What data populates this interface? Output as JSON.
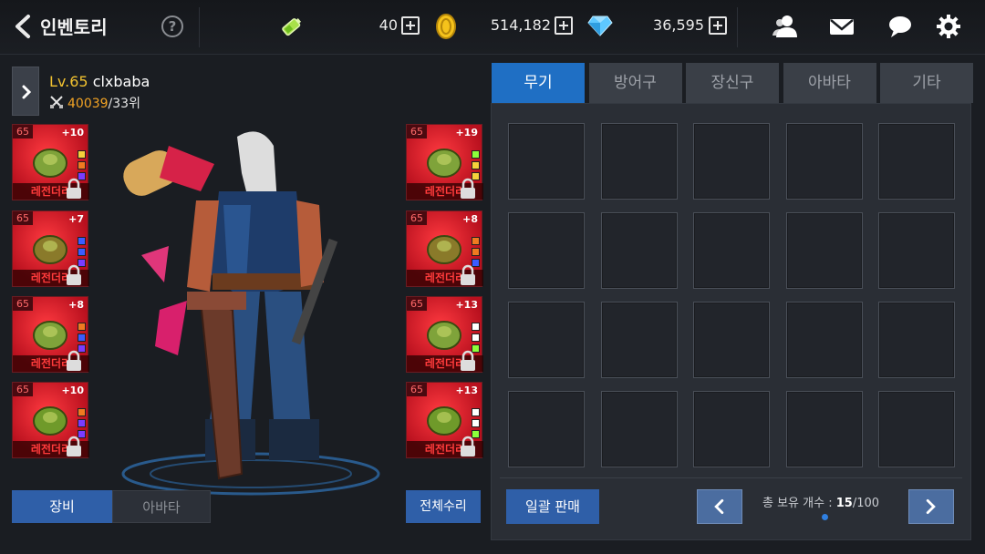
{
  "header": {
    "title": "인벤토리",
    "help": "?",
    "stamina": "40",
    "gold": "514,182",
    "gems": "36,595"
  },
  "character": {
    "level_prefix": "Lv.65",
    "name": "clxbaba",
    "power": "40039",
    "rank": "/33위"
  },
  "equip_left": [
    {
      "level": "65",
      "enhance": "+10",
      "grade": "레전더리",
      "gems": [
        "#f5d13b",
        "#f07a20",
        "#7a3cff"
      ]
    },
    {
      "level": "65",
      "enhance": "+7",
      "grade": "레전더리",
      "gems": [
        "#3b5cff",
        "#3b5cff",
        "#7a3cff"
      ]
    },
    {
      "level": "65",
      "enhance": "+8",
      "grade": "레전더리",
      "gems": [
        "#f07a20",
        "#3b5cff",
        "#7a3cff"
      ]
    },
    {
      "level": "65",
      "enhance": "+10",
      "grade": "레전더리",
      "gems": [
        "#f07a20",
        "#7a3cff",
        "#7a3cff"
      ]
    }
  ],
  "equip_right": [
    {
      "level": "65",
      "enhance": "+19",
      "grade": "레전더리",
      "gems": [
        "#8cff3b",
        "#f5d13b",
        "#f5d13b"
      ]
    },
    {
      "level": "65",
      "enhance": "+8",
      "grade": "레전더리",
      "gems": [
        "#f07a20",
        "#f07a20",
        "#3b5cff"
      ]
    },
    {
      "level": "65",
      "enhance": "+13",
      "grade": "레전더리",
      "gems": [
        "#ffffff",
        "#ffffff",
        "#8cff3b"
      ]
    },
    {
      "level": "65",
      "enhance": "+13",
      "grade": "레전더리",
      "gems": [
        "#ffffff",
        "#ffffff",
        "#8cff3b"
      ]
    }
  ],
  "bottom_left": {
    "equip_tab": "장비",
    "avatar_tab": "아바타",
    "repair_all": "전체수리"
  },
  "inventory": {
    "tabs": [
      "무기",
      "방어구",
      "장신구",
      "아바타",
      "기타"
    ],
    "active_tab": "무기",
    "sell_all": "일괄 판매",
    "count_label": "총 보유 개수 : ",
    "count_current": "15",
    "count_max": "/100"
  },
  "colors": {
    "accent_blue": "#1f6fc4",
    "button_blue": "#2f5fa8",
    "legendary_red": "#e0202c",
    "level_yellow": "#f2c230"
  }
}
